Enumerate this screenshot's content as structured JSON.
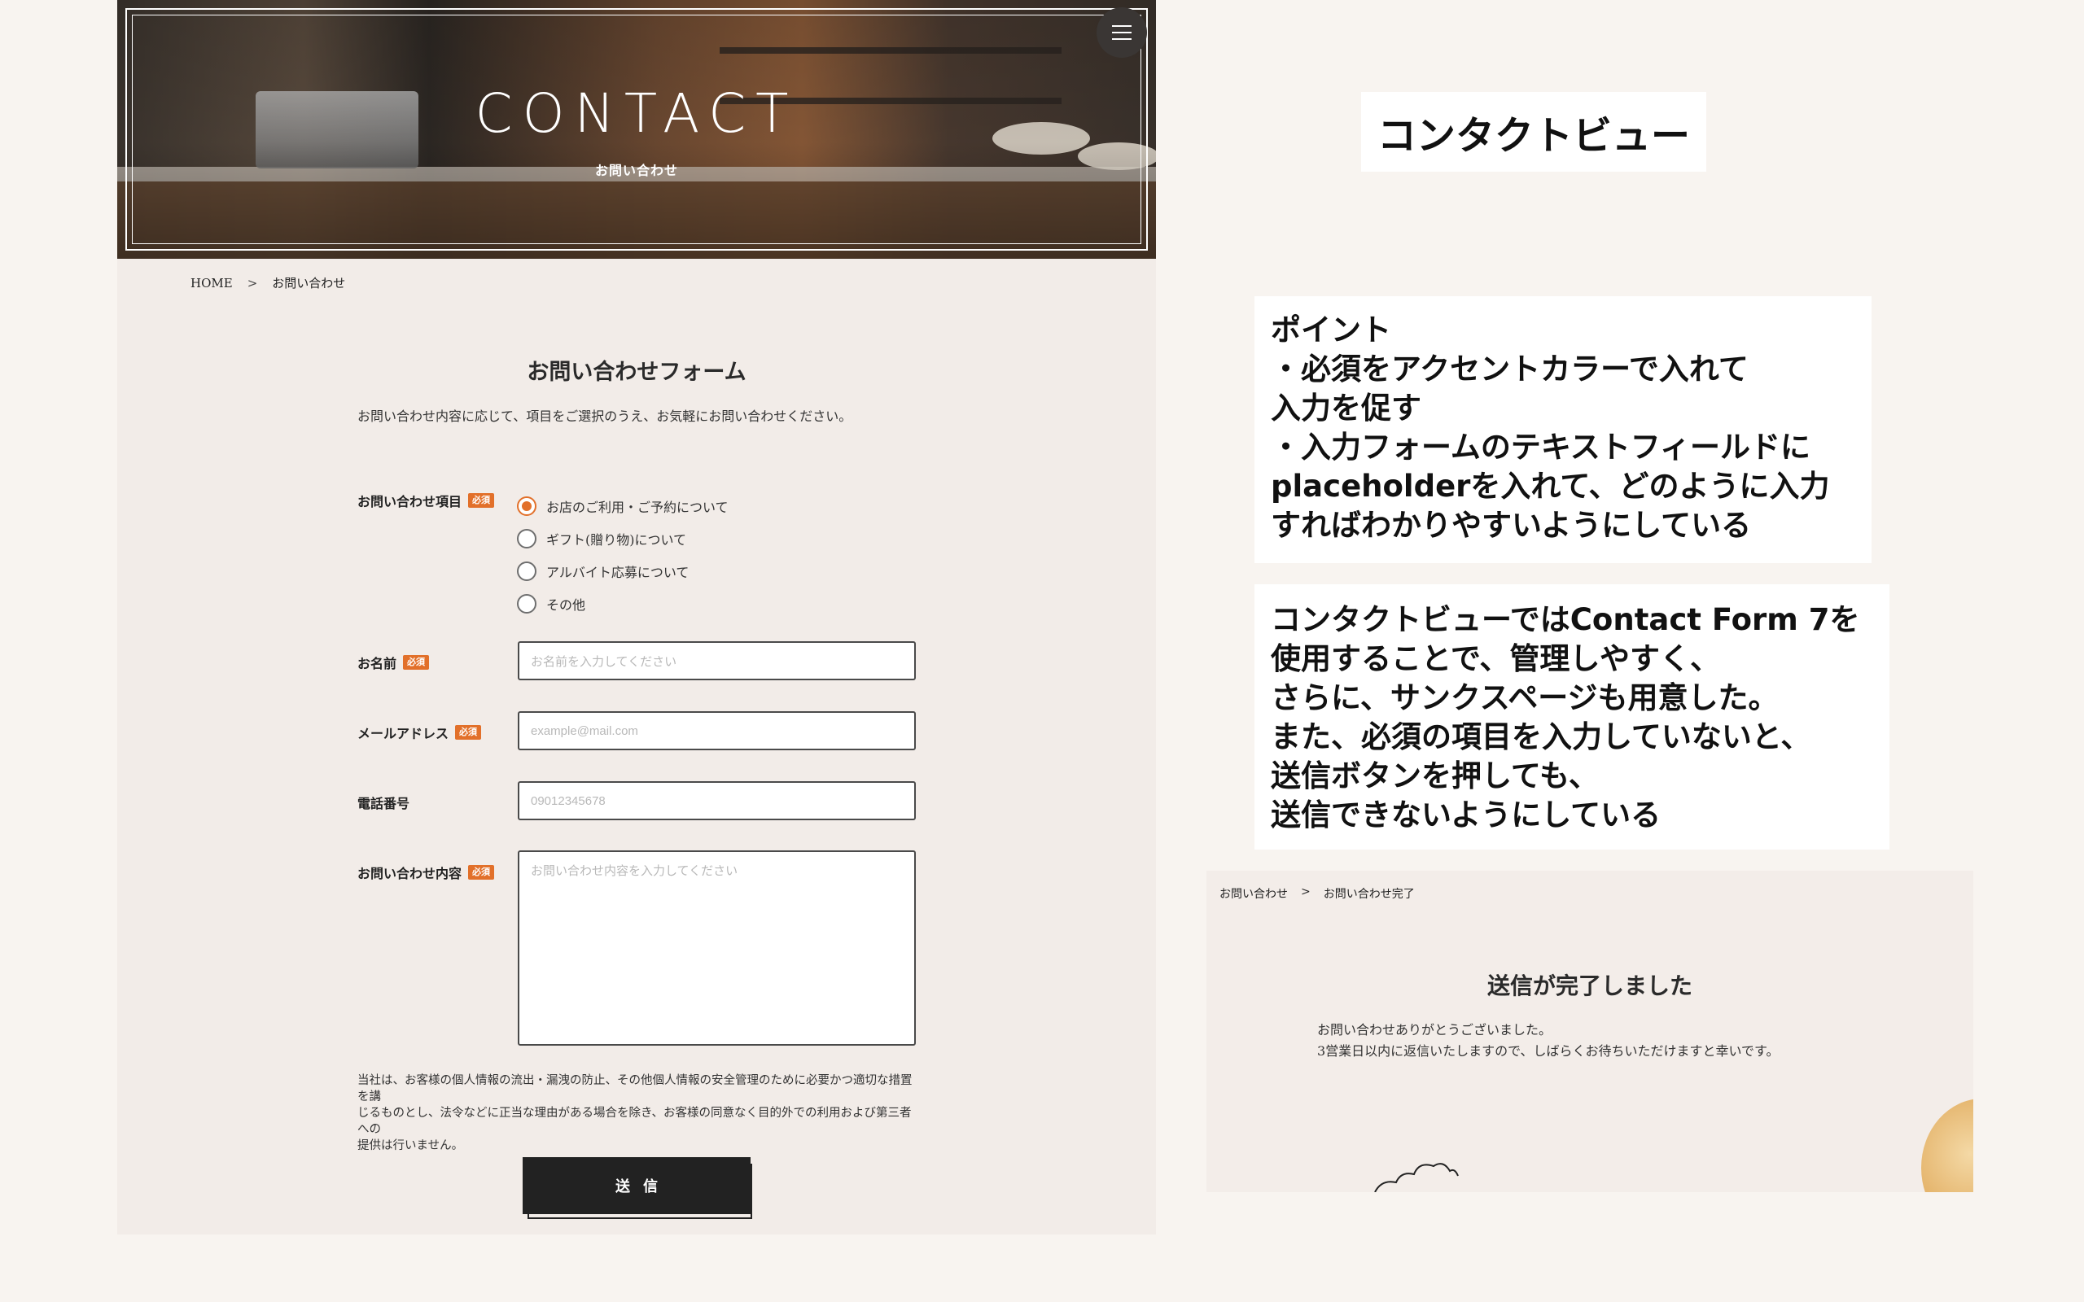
{
  "hero": {
    "title": "CONTACT",
    "subtitle": "お問い合わせ",
    "menu_icon": "hamburger-menu-icon"
  },
  "breadcrumb": {
    "home": "HOME",
    "separator": ">",
    "current": "お問い合わせ"
  },
  "form": {
    "title": "お問い合わせフォーム",
    "lead": "お問い合わせ内容に応じて、項目をご選択のうえ、お気軽にお問い合わせください。",
    "required_badge": "必須",
    "accent_color": "#e2702a",
    "inquiry_type": {
      "label": "お問い合わせ項目",
      "selected": "お店のご利用・ご予約について",
      "options": [
        "お店のご利用・ご予約について",
        "ギフト(贈り物)について",
        "アルバイト応募について",
        "その他"
      ]
    },
    "name": {
      "label": "お名前",
      "placeholder": "お名前を入力してください"
    },
    "email": {
      "label": "メールアドレス",
      "placeholder": "example@mail.com"
    },
    "phone": {
      "label": "電話番号",
      "placeholder": "09012345678"
    },
    "message": {
      "label": "お問い合わせ内容",
      "placeholder": "お問い合わせ内容を入力してください"
    },
    "privacy_lines": [
      "当社は、お客様の個人情報の流出・漏洩の防止、その他個人情報の安全管理のために必要かつ適切な措置を講",
      "じるものとし、法令などに正当な理由がある場合を除き、お客様の同意なく目的外での利用および第三者への",
      "提供は行いません。"
    ],
    "submit_label": "送信"
  },
  "annotations": {
    "title": "コンタクトビュー",
    "points_lines": [
      "ポイント",
      "・必須をアクセントカラーで入れて",
      "入力を促す",
      "・入力フォームのテキストフィールドに",
      "placeholderを入れて、どのように入力",
      "すればわかりやすいようにしている"
    ],
    "description_lines": [
      "コンタクトビューではContact Form 7を",
      "使用することで、管理しやすく、",
      "さらに、サンクスページも用意した。",
      "また、必須の項目を入力していないと、",
      "送信ボタンを押しても、",
      "送信できないようにしている"
    ]
  },
  "thanks_page": {
    "breadcrumb_parent": "お問い合わせ",
    "breadcrumb_separator": ">",
    "breadcrumb_current": "お問い合わせ完了",
    "heading": "送信が完了しました",
    "message_line1": "お問い合わせありがとうございました。",
    "message_line2": "3営業日以内に返信いたしますので、しばらくお待ちいただけますと幸いです。"
  }
}
